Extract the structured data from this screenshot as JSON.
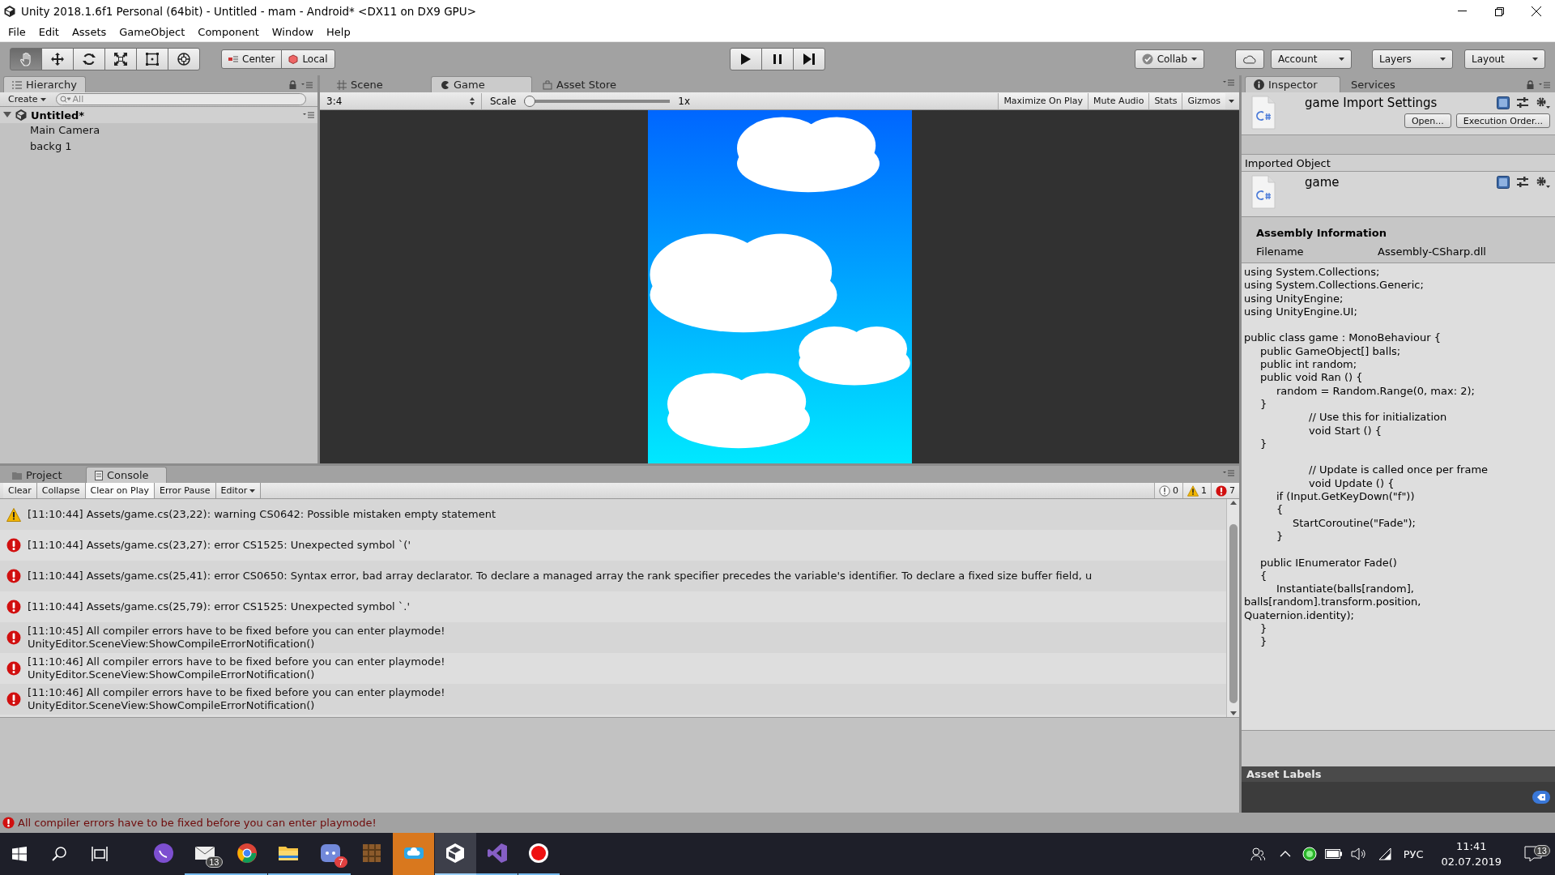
{
  "window": {
    "title": "Unity 2018.1.6f1 Personal (64bit) - Untitled - mam - Android* <DX11 on DX9 GPU>"
  },
  "menu": [
    "File",
    "Edit",
    "Assets",
    "GameObject",
    "Component",
    "Window",
    "Help"
  ],
  "tools": [
    {
      "kind": "hand",
      "selected": true
    },
    {
      "kind": "move",
      "selected": false
    },
    {
      "kind": "rotate",
      "selected": false
    },
    {
      "kind": "scale",
      "selected": false
    },
    {
      "kind": "rect",
      "selected": false
    },
    {
      "kind": "transform",
      "selected": false
    }
  ],
  "pivot": {
    "position": "Center",
    "rotation": "Local"
  },
  "toolbar_right": {
    "collab": "Collab",
    "account": "Account",
    "layers": "Layers",
    "layout": "Layout"
  },
  "hierarchy": {
    "tab": "Hierarchy",
    "create": "Create",
    "search_placeholder": "All",
    "scene": "Untitled*",
    "objects": [
      "Main Camera",
      "backg 1"
    ]
  },
  "view_tabs": [
    {
      "kind": "scene",
      "label": "Scene",
      "selected": false
    },
    {
      "kind": "game",
      "label": "Game",
      "selected": true
    },
    {
      "kind": "store",
      "label": "Asset Store",
      "selected": false
    }
  ],
  "game_bar": {
    "aspect": "3:4",
    "scale_label": "Scale",
    "scale": {
      "level": 0
    },
    "scale_value": "1x",
    "toggles": [
      {
        "label": "Maximize On Play",
        "on": false
      },
      {
        "label": "Mute Audio",
        "on": false
      },
      {
        "label": "Stats",
        "on": false
      },
      {
        "label": "Gizmos",
        "on": false
      }
    ]
  },
  "bottom_tabs": [
    {
      "kind": "project",
      "label": "Project",
      "selected": false
    },
    {
      "kind": "console",
      "label": "Console",
      "selected": true
    }
  ],
  "console": {
    "buttons": [
      {
        "kind": "button",
        "label": "Clear"
      },
      {
        "kind": "toggle",
        "label": "Collapse",
        "on": false
      },
      {
        "kind": "toggle",
        "label": "Clear on Play",
        "on": true
      },
      {
        "kind": "toggle",
        "label": "Error Pause",
        "on": false
      },
      {
        "kind": "dropdown",
        "label": "Editor"
      }
    ],
    "counts": [
      {
        "kind": "info",
        "count": "0"
      },
      {
        "kind": "warning",
        "count": "1"
      },
      {
        "kind": "error",
        "count": "7"
      }
    ],
    "messages": [
      {
        "kind": "warning",
        "lines": [
          "[11:10:44] Assets/game.cs(23,22): warning CS0642: Possible mistaken empty statement"
        ]
      },
      {
        "kind": "error",
        "lines": [
          "[11:10:44] Assets/game.cs(23,27): error CS1525: Unexpected symbol `('"
        ]
      },
      {
        "kind": "error",
        "lines": [
          "[11:10:44] Assets/game.cs(25,41): error CS0650: Syntax error, bad array declarator. To declare a managed array the rank specifier precedes the variable's identifier. To declare a fixed size buffer field, u"
        ]
      },
      {
        "kind": "error",
        "lines": [
          "[11:10:44] Assets/game.cs(25,79): error CS1525: Unexpected symbol `.'"
        ]
      },
      {
        "kind": "error",
        "lines": [
          "[11:10:45] All compiler errors have to be fixed before you can enter playmode!",
          "UnityEditor.SceneView:ShowCompileErrorNotification()"
        ]
      },
      {
        "kind": "error",
        "lines": [
          "[11:10:46] All compiler errors have to be fixed before you can enter playmode!",
          "UnityEditor.SceneView:ShowCompileErrorNotification()"
        ]
      },
      {
        "kind": "error",
        "lines": [
          "[11:10:46] All compiler errors have to be fixed before you can enter playmode!",
          "UnityEditor.SceneView:ShowCompileErrorNotification()"
        ]
      }
    ]
  },
  "inspector": {
    "tabs": [
      {
        "label": "Inspector",
        "selected": true
      },
      {
        "label": "Services",
        "selected": false
      }
    ],
    "title": "game Import Settings",
    "open": "Open...",
    "execution_order": "Execution Order...",
    "imported_label": "Imported Object",
    "object_name": "game",
    "assembly_title": "Assembly Information",
    "filename_label": "Filename",
    "filename": "Assembly-CSharp.dll",
    "code": [
      [
        "using System.Collections;",
        "using System.Collections.Generic;",
        "using UnityEngine;",
        "using UnityEngine.UI;"
      ],
      [
        "public class game : MonoBehaviour {",
        "\tpublic GameObject[] balls;",
        "\tpublic int random;",
        "\tpublic void Ran () {",
        "\t\trandom = Random.Range(0, max: 2);",
        "\t}",
        "\t\t\t\t// Use this for initialization",
        "\t\t\t\tvoid Start () {",
        "\t}"
      ],
      [
        "\t\t\t\t// Update is called once per frame",
        "\t\t\t\tvoid Update () {",
        "\t\tif (Input.GetKeyDown(\"f\"))",
        "\t\t{",
        "\t\t\tStartCoroutine(\"Fade\");",
        "\t\t}"
      ],
      [
        "\tpublic IEnumerator Fade()",
        "\t{",
        "\t\tInstantiate(balls[random],",
        "balls[random].transform.position,",
        "Quaternion.identity);",
        "\t}",
        "\t}"
      ]
    ],
    "labels_title": "Asset Labels"
  },
  "status_bar": {
    "message": "All compiler errors have to be fixed before you can enter playmode!"
  },
  "taskbar": {
    "apps": [
      {
        "kind": "messenger",
        "running": false,
        "active": false,
        "flashing": false
      },
      {
        "kind": "mail",
        "running": true,
        "active": false,
        "flashing": false,
        "badge": "13"
      },
      {
        "kind": "browser",
        "running": true,
        "active": false,
        "flashing": false
      },
      {
        "kind": "folder",
        "running": true,
        "active": false,
        "flashing": false
      },
      {
        "kind": "chat",
        "running": true,
        "active": false,
        "flashing": false,
        "badge": "7"
      },
      {
        "kind": "crate",
        "running": false,
        "active": false,
        "flashing": false
      },
      {
        "kind": "cloud",
        "running": false,
        "active": false,
        "flashing": true
      },
      {
        "kind": "unity",
        "running": true,
        "active": true,
        "flashing": false
      },
      {
        "kind": "studio",
        "running": true,
        "active": false,
        "flashing": false
      },
      {
        "kind": "record",
        "running": true,
        "active": false,
        "flashing": false
      }
    ],
    "language": "РУС",
    "time": "11:41",
    "date": "02.07.2019",
    "notifications": "13"
  }
}
